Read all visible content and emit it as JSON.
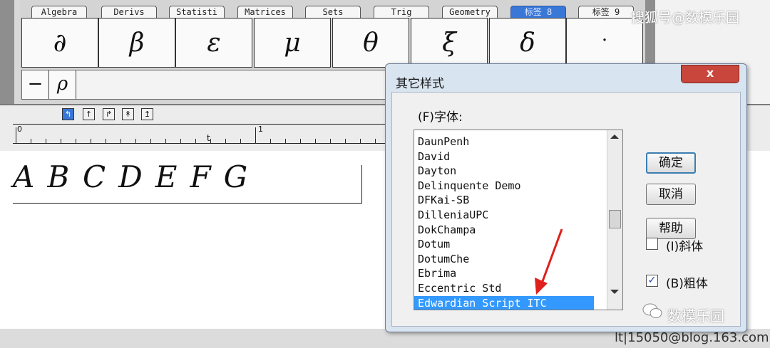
{
  "palette": {
    "tabs": [
      {
        "label": "Algebra",
        "active": false
      },
      {
        "label": "Derivs",
        "active": false
      },
      {
        "label": "Statisti",
        "active": false
      },
      {
        "label": "Matrices",
        "active": false
      },
      {
        "label": "Sets",
        "active": false
      },
      {
        "label": "Trig",
        "active": false
      },
      {
        "label": "Geometry",
        "active": false
      },
      {
        "label": "标签 8",
        "active": true
      },
      {
        "label": "标签 9",
        "active": false
      }
    ],
    "symbols": [
      "∂",
      "β",
      "ε",
      "μ",
      "θ",
      "ξ",
      "δ",
      "·"
    ],
    "row2_symbols": [
      "−",
      "ρ"
    ]
  },
  "toolbar": {
    "align_buttons": [
      "↰",
      "↑",
      "↱",
      "↟",
      "↥"
    ]
  },
  "ruler": {
    "label_0": "0",
    "label_1": "1",
    "tab_marker": "t"
  },
  "editor": {
    "content": "ABCDEFG"
  },
  "dialog": {
    "title": "其它样式",
    "close_label": "x",
    "font_label": "(F)字体:",
    "fonts": [
      "DaunPenh",
      "David",
      "Dayton",
      "Delinquente Demo",
      "DFKai-SB",
      "DilleniaUPC",
      "DokChampa",
      "Dotum",
      "DotumChe",
      "Ebrima",
      "Eccentric Std",
      "Edwardian Script ITC"
    ],
    "selected_font": "Edwardian Script ITC",
    "ok_label": "确定",
    "cancel_label": "取消",
    "help_label": "帮助",
    "italic_label": "(I)斜体",
    "italic_checked": false,
    "bold_label": "(B)粗体",
    "bold_checked": true
  },
  "watermarks": {
    "top": "搜狐号@数模乐园",
    "bottom": "数模乐园",
    "bottom_url": "lt|15050@blog.163.com"
  },
  "colors": {
    "accent": "#3399ff",
    "close": "#c9463c",
    "arrow": "#e0201c"
  }
}
